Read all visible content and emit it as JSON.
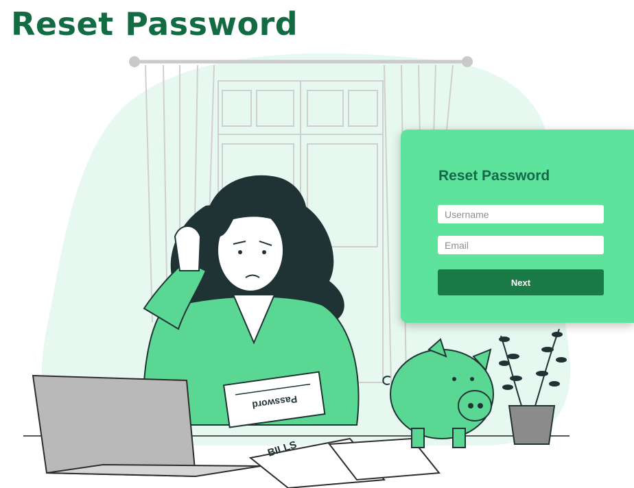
{
  "page": {
    "title": "Reset Password"
  },
  "illustration": {
    "letter_text": "Password",
    "bills_text": "BILLS"
  },
  "form": {
    "title": "Reset Password",
    "username_placeholder": "Username",
    "email_placeholder": "Email",
    "next_label": "Next"
  },
  "colors": {
    "brand_dark": "#136b43",
    "card_bg": "#5de39c",
    "button_bg": "#1a7a48",
    "blob_bg": "#e6f8ef",
    "accent_green": "#5bd794"
  }
}
